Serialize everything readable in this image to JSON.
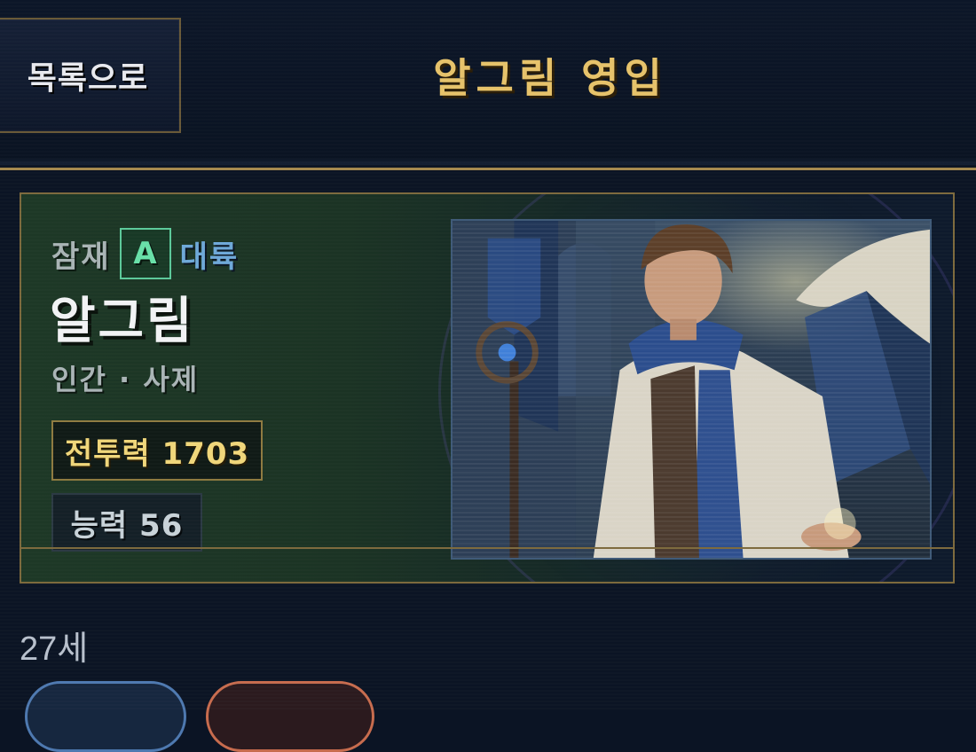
{
  "header": {
    "back_label": "목록으로",
    "title": "알그림 영입"
  },
  "character": {
    "potential_label": "잠재",
    "grade": "A",
    "category": "대륙",
    "name": "알그림",
    "race_class": "인간 · 사제",
    "power_label": "전투력 1703",
    "ability_label": "능력 56",
    "age": "27세"
  },
  "colors": {
    "accent_gold": "#e6c26a",
    "grade_green": "#68e0a8",
    "category_blue": "#6ea8d8",
    "background": "#0b1424"
  }
}
